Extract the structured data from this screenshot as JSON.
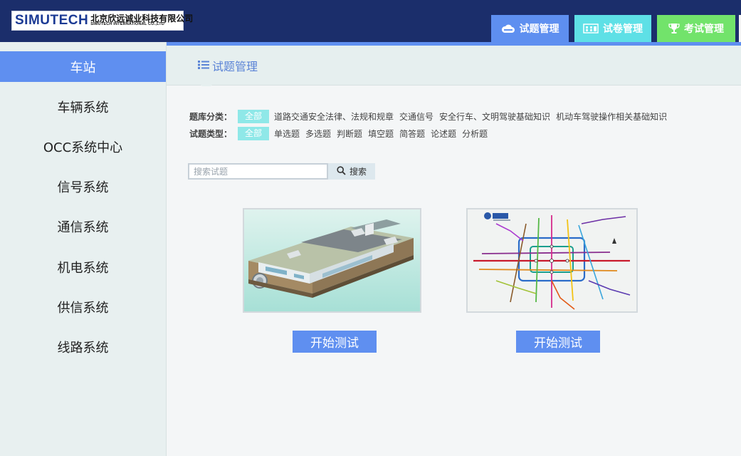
{
  "header": {
    "logo_brand": "SIMUTECH",
    "logo_cn": "北京欣远诚业科技有限公司",
    "logo_en": "SIMUTECH INTERNATIONAL CO.,LTD",
    "tabs": [
      {
        "label": "试题管理",
        "icon": "cloud-icon",
        "color": "#5e8ff0"
      },
      {
        "label": "试卷管理",
        "icon": "exam-paper-icon",
        "color": "#5ee0e6"
      },
      {
        "label": "考试管理",
        "icon": "trophy-icon",
        "color": "#72e36b"
      }
    ]
  },
  "sidebar": {
    "items": [
      {
        "label": "车站",
        "active": true
      },
      {
        "label": "车辆系统"
      },
      {
        "label": "OCC系统中心"
      },
      {
        "label": "信号系统"
      },
      {
        "label": "通信系统"
      },
      {
        "label": "机电系统"
      },
      {
        "label": "供信系统"
      },
      {
        "label": "线路系统"
      }
    ]
  },
  "main": {
    "title": "试题管理",
    "filters": {
      "category_label": "题库分类：",
      "category_all": "全部",
      "categories": [
        "道路交通安全法律、法规和规章",
        "交通信号",
        "安全行车、文明驾驶基础知识",
        "机动车驾驶操作相关基础知识"
      ],
      "type_label": "试题类型：",
      "type_all": "全部",
      "types": [
        "单选题",
        "多选题",
        "判断题",
        "填空题",
        "简答题",
        "论述题",
        "分析题"
      ]
    },
    "search": {
      "placeholder": "搜索试题",
      "button": "搜索"
    },
    "cards": [
      {
        "image": "station-3d-model",
        "button": "开始测试"
      },
      {
        "image": "metro-map",
        "button": "开始测试"
      }
    ]
  },
  "colors": {
    "header_bg": "#1b2e6b",
    "accent": "#5f8ff0",
    "chip": "#8fe8e8"
  }
}
